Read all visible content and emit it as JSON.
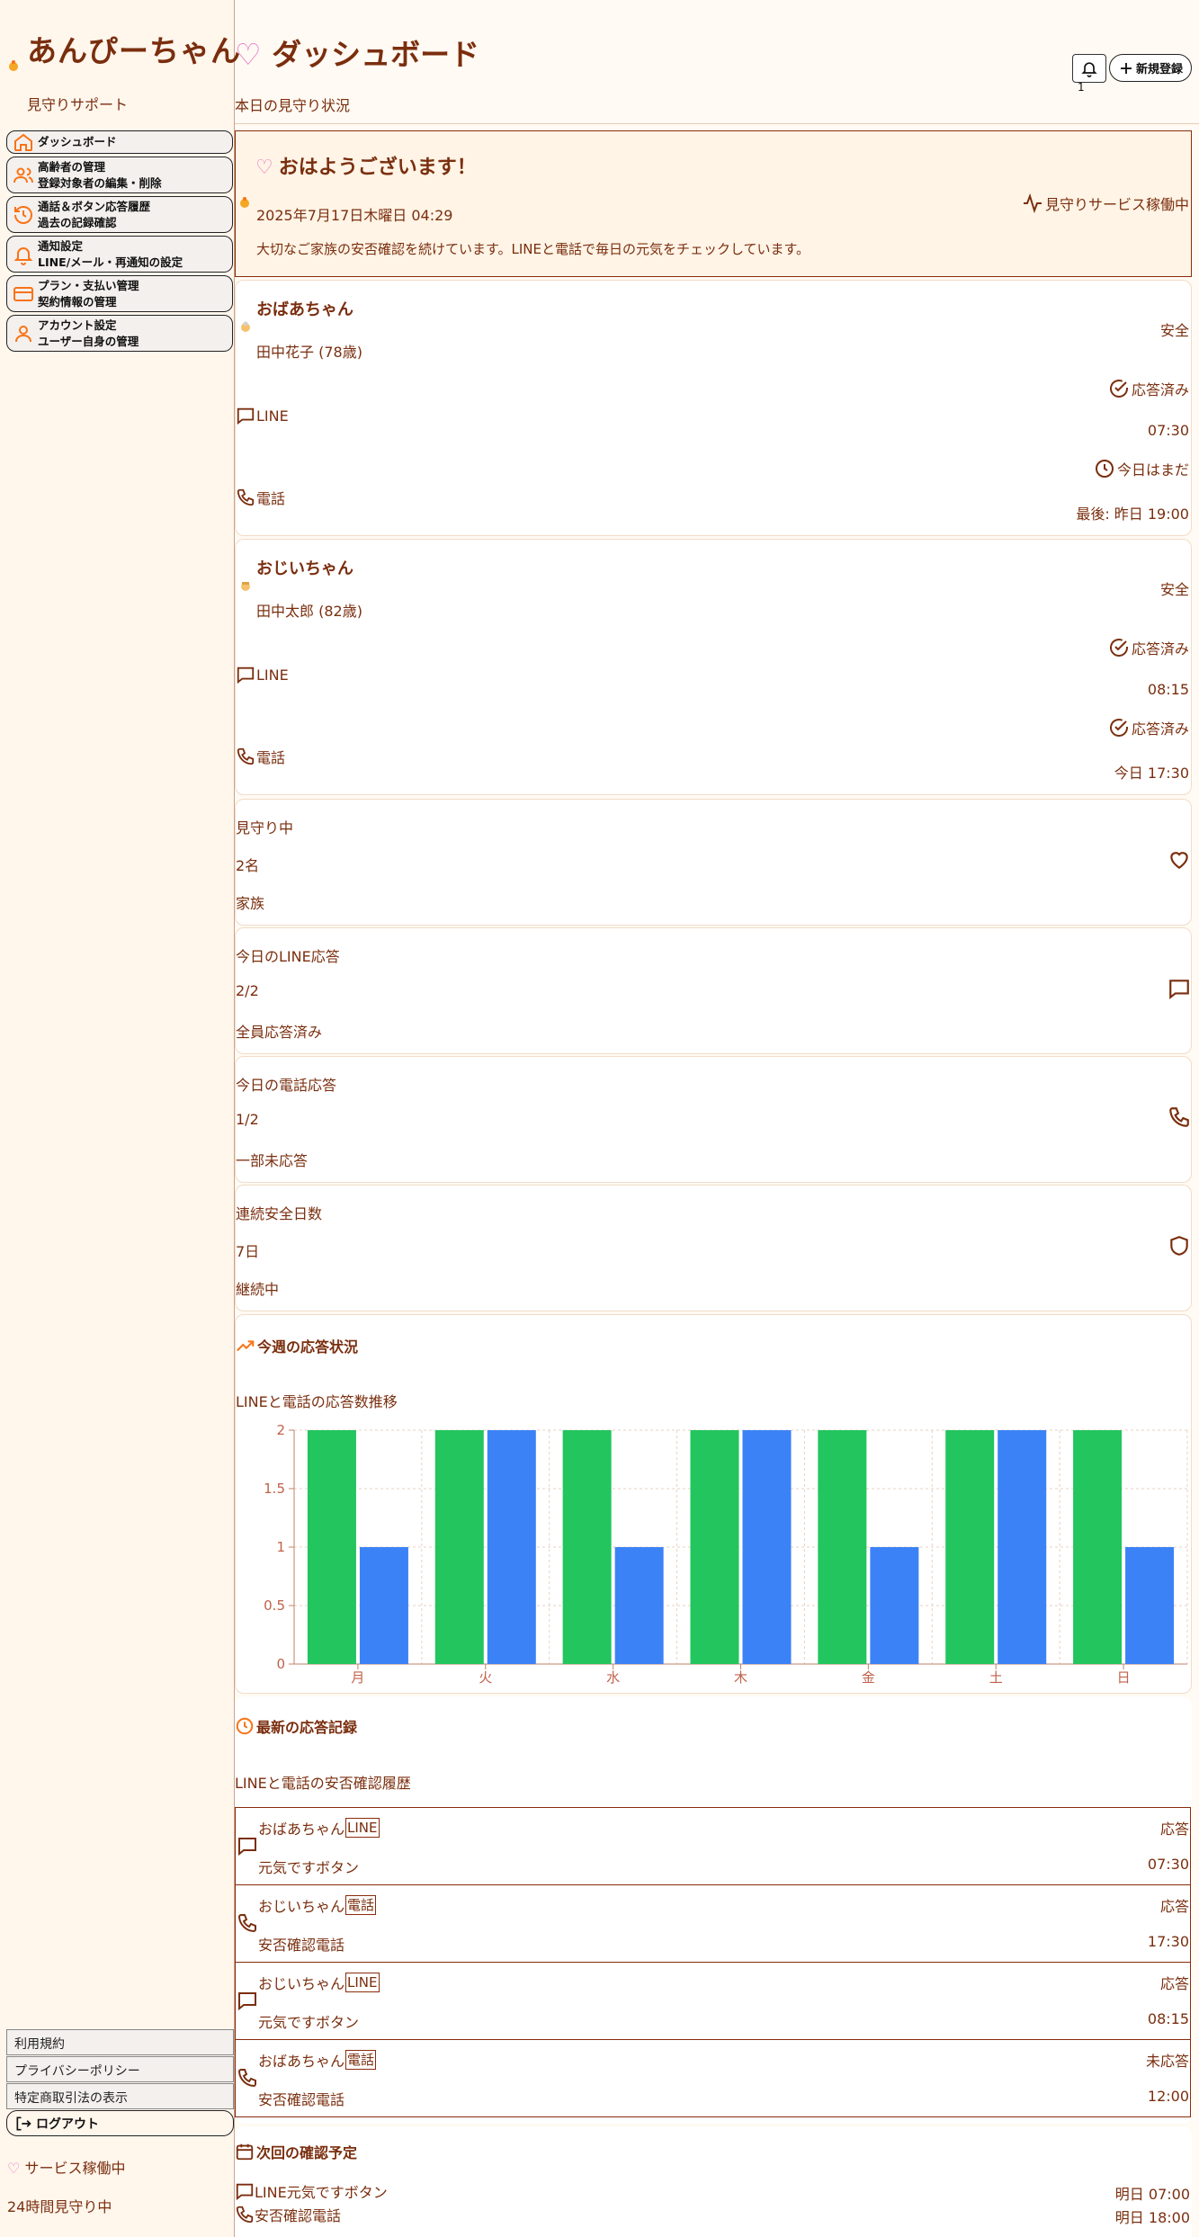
{
  "brand": {
    "title": "あんぴーちゃん",
    "subtitle": "見守りサポート"
  },
  "nav": [
    {
      "label": "ダッシュボード",
      "sub": ""
    },
    {
      "label": "高齢者の管理",
      "sub": "登録対象者の編集・削除"
    },
    {
      "label": "通話＆ボタン応答履歴",
      "sub": "過去の記録確認"
    },
    {
      "label": "通知設定",
      "sub": "LINE/メール・再通知の設定"
    },
    {
      "label": "プラン・支払い管理",
      "sub": "契約情報の管理"
    },
    {
      "label": "アカウント設定",
      "sub": "ユーザー自身の管理"
    }
  ],
  "footer_links": [
    "利用規約",
    "プライバシーポリシー",
    "特定商取引法の表示"
  ],
  "logout_label": "ログアウト",
  "service_status": {
    "heart": "♡",
    "label": "サービス稼働中",
    "sub": "24時間見守り中"
  },
  "header": {
    "heart": "♡",
    "title": "ダッシュボード",
    "subtitle": "本日の見守り状況",
    "notification_count": "1",
    "new_button": "新規登録"
  },
  "greeting": {
    "heart": "♡",
    "title": "おはようございます！",
    "date": "2025年7月17日木曜日 04:29",
    "status": "見守りサービス稼働中",
    "message": "大切なご家族の安否確認を続けています。LINEと電話で毎日の元気をチェックしています。"
  },
  "persons": [
    {
      "name": "おばあちゃん",
      "detail": "田中花子 (78歳)",
      "safety": "安全",
      "line": {
        "label": "LINE",
        "status": "応答済み",
        "time": "07:30"
      },
      "phone": {
        "label": "電話",
        "status": "今日はまだ",
        "time": "最後: 昨日 19:00"
      }
    },
    {
      "name": "おじいちゃん",
      "detail": "田中太郎 (82歳)",
      "safety": "安全",
      "line": {
        "label": "LINE",
        "status": "応答済み",
        "time": "08:15"
      },
      "phone": {
        "label": "電話",
        "status": "応答済み",
        "time": "今日 17:30"
      }
    }
  ],
  "stats": [
    {
      "label": "見守り中",
      "value": "2名",
      "note": "家族",
      "icon": "heart-icon"
    },
    {
      "label": "今日のLINE応答",
      "value": "2/2",
      "note": "全員応答済み",
      "icon": "message-icon"
    },
    {
      "label": "今日の電話応答",
      "value": "1/2",
      "note": "一部未応答",
      "icon": "phone-icon"
    },
    {
      "label": "連続安全日数",
      "value": "7日",
      "note": "継続中",
      "icon": "shield-icon"
    }
  ],
  "weekly": {
    "title": "今週の応答状況",
    "subtitle": "LINEと電話の応答数推移"
  },
  "chart_data": {
    "type": "bar",
    "categories": [
      "月",
      "火",
      "水",
      "木",
      "金",
      "土",
      "日"
    ],
    "series": [
      {
        "values": [
          2,
          2,
          2,
          2,
          2,
          2,
          2
        ],
        "color": "#22c55e"
      },
      {
        "values": [
          1,
          2,
          1,
          2,
          1,
          2,
          1
        ],
        "color": "#3b82f6"
      }
    ],
    "ylim": [
      0,
      2
    ],
    "yticks": [
      "0",
      "0.5",
      "1",
      "1.5",
      "2"
    ],
    "grid": true
  },
  "records": {
    "title": "最新の応答記録",
    "subtitle": "LINEと電話の安否確認履歴",
    "items": [
      {
        "name": "おばあちゃん",
        "channel": "LINE",
        "desc": "元気ですボタン",
        "status": "応答",
        "time": "07:30",
        "icon": "message-icon"
      },
      {
        "name": "おじいちゃん",
        "channel": "電話",
        "desc": "安否確認電話",
        "status": "応答",
        "time": "17:30",
        "icon": "phone-icon"
      },
      {
        "name": "おじいちゃん",
        "channel": "LINE",
        "desc": "元気ですボタン",
        "status": "応答",
        "time": "08:15",
        "icon": "message-icon"
      },
      {
        "name": "おばあちゃん",
        "channel": "電話",
        "desc": "安否確認電話",
        "status": "未応答",
        "time": "12:00",
        "icon": "phone-icon"
      }
    ]
  },
  "next": {
    "title": "次回の確認予定",
    "items": [
      {
        "label": "LINE元気ですボタン",
        "time": "明日 07:00"
      },
      {
        "label": "安否確認電話",
        "time": "明日 18:00"
      }
    ]
  },
  "colors": {
    "accent": "#f97316",
    "text": "#7a2e0e",
    "heart": "#e879c9",
    "line_green": "#22c55e",
    "phone_blue": "#3b82f6"
  }
}
